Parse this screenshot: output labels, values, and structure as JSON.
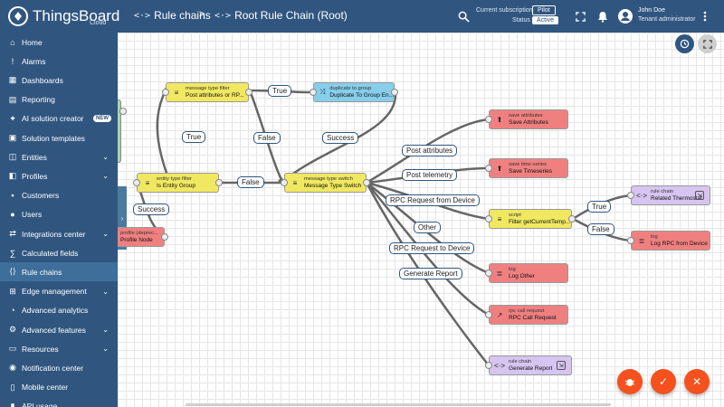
{
  "app": {
    "logo_text": "ThingsBoard",
    "logo_sub": "Cloud"
  },
  "breadcrumb": {
    "parent": "Rule chains",
    "separator": ">",
    "current": "Root Rule Chain (Root)"
  },
  "subscription": {
    "label": "Current subscription",
    "plan": "Pilot",
    "status_label": "Status",
    "status": "Active"
  },
  "user": {
    "name": "John Doe",
    "role": "Tenant administrator"
  },
  "sidebar": {
    "items": [
      {
        "label": "Home",
        "icon": "home-icon"
      },
      {
        "label": "Alarms",
        "icon": "alarm-icon"
      },
      {
        "label": "Dashboards",
        "icon": "dashboards-icon"
      },
      {
        "label": "Reporting",
        "icon": "reporting-icon"
      },
      {
        "label": "AI solution creator",
        "icon": "ai-icon",
        "badge": "NEW"
      },
      {
        "label": "Solution templates",
        "icon": "templates-icon"
      },
      {
        "label": "Entities",
        "icon": "entities-icon",
        "expandable": true
      },
      {
        "label": "Profiles",
        "icon": "profiles-icon",
        "expandable": true
      },
      {
        "label": "Customers",
        "icon": "customers-icon"
      },
      {
        "label": "Users",
        "icon": "users-icon"
      },
      {
        "label": "Integrations center",
        "icon": "integrations-icon",
        "expandable": true
      },
      {
        "label": "Calculated fields",
        "icon": "calculated-fields-icon"
      },
      {
        "label": "Rule chains",
        "icon": "rule-chains-icon",
        "active": true
      },
      {
        "label": "Edge management",
        "icon": "edge-icon",
        "expandable": true
      },
      {
        "label": "Advanced analytics",
        "icon": "analytics-icon"
      },
      {
        "label": "Advanced features",
        "icon": "advanced-features-icon",
        "expandable": true
      },
      {
        "label": "Resources",
        "icon": "resources-icon",
        "expandable": true
      },
      {
        "label": "Notification center",
        "icon": "notification-icon"
      },
      {
        "label": "Mobile center",
        "icon": "mobile-icon"
      },
      {
        "label": "API usage",
        "icon": "api-usage-icon"
      }
    ]
  },
  "nodes": {
    "msg_type_filter": {
      "type": "message type filter",
      "name": "Post attributes or RP..."
    },
    "duplicate_group": {
      "type": "duplicate to group",
      "name": "Duplicate To Group En..."
    },
    "entity_type_filter": {
      "type": "entity type filter",
      "name": "Is Entity Group"
    },
    "device_profile": {
      "type": "profile (deprec...",
      "name": "Profile Node"
    },
    "msg_type_switch": {
      "type": "message type switch",
      "name": "Message Type Switch"
    },
    "save_attributes": {
      "type": "save attributes",
      "name": "Save Attributes"
    },
    "save_timeseries": {
      "type": "save time series",
      "name": "Save Timeseries"
    },
    "script": {
      "type": "script",
      "name": "Filter getCurrentTemp..."
    },
    "rule_chain_thermostat": {
      "type": "rule chain",
      "name": "Related Thermostat"
    },
    "log_rpc": {
      "type": "log",
      "name": "Log RPC from Device"
    },
    "log_other": {
      "type": "log",
      "name": "Log Other"
    },
    "rpc_call": {
      "type": "rpc call request",
      "name": "RPC Call Request"
    },
    "rule_chain_report": {
      "type": "rule chain",
      "name": "Generate Report"
    }
  },
  "links": {
    "true_1": "True",
    "false_1": "False",
    "success_1": "Success",
    "true_2": "True",
    "false_2": "False",
    "success_2": "Success",
    "post_attributes": "Post attributes",
    "post_telemetry": "Post telemetry",
    "rpc_from_device": "RPC Request from Device",
    "other": "Other",
    "rpc_to_device": "RPC Request to Device",
    "generate_report": "Generate Report",
    "true_3": "True",
    "false_3": "False"
  },
  "colors": {
    "primary": "#305680",
    "accent": "#f4511e",
    "filter_node": "#f1e861",
    "action_node": "#f08080",
    "transform_node": "#87ceeb",
    "flow_node": "#d6c4f1"
  }
}
